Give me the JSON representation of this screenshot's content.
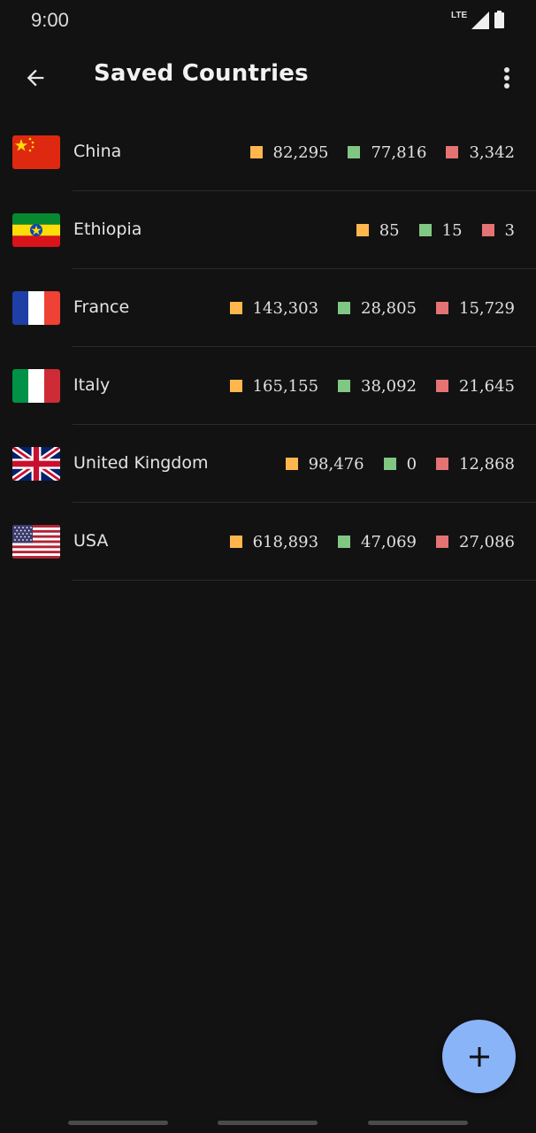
{
  "status": {
    "time": "9:00",
    "network": "LTE"
  },
  "header": {
    "title": "Saved Countries",
    "back_icon": "arrow-back-icon",
    "menu_icon": "more-vert-icon"
  },
  "colors": {
    "background": "#121212",
    "confirmed": "#FFB74D",
    "recovered": "#81C784",
    "deaths": "#E57373",
    "fab": "#8AB4F8"
  },
  "countries": [
    {
      "name": "China",
      "flag": "china-flag",
      "confirmed": "82,295",
      "recovered": "77,816",
      "deaths": "3,342"
    },
    {
      "name": "Ethiopia",
      "flag": "ethiopia-flag",
      "confirmed": "85",
      "recovered": "15",
      "deaths": "3"
    },
    {
      "name": "France",
      "flag": "france-flag",
      "confirmed": "143,303",
      "recovered": "28,805",
      "deaths": "15,729"
    },
    {
      "name": "Italy",
      "flag": "italy-flag",
      "confirmed": "165,155",
      "recovered": "38,092",
      "deaths": "21,645"
    },
    {
      "name": "United Kingdom",
      "flag": "uk-flag",
      "confirmed": "98,476",
      "recovered": "0",
      "deaths": "12,868"
    },
    {
      "name": "USA",
      "flag": "usa-flag",
      "confirmed": "618,893",
      "recovered": "47,069",
      "deaths": "27,086"
    }
  ],
  "fab": {
    "icon": "add-icon"
  }
}
